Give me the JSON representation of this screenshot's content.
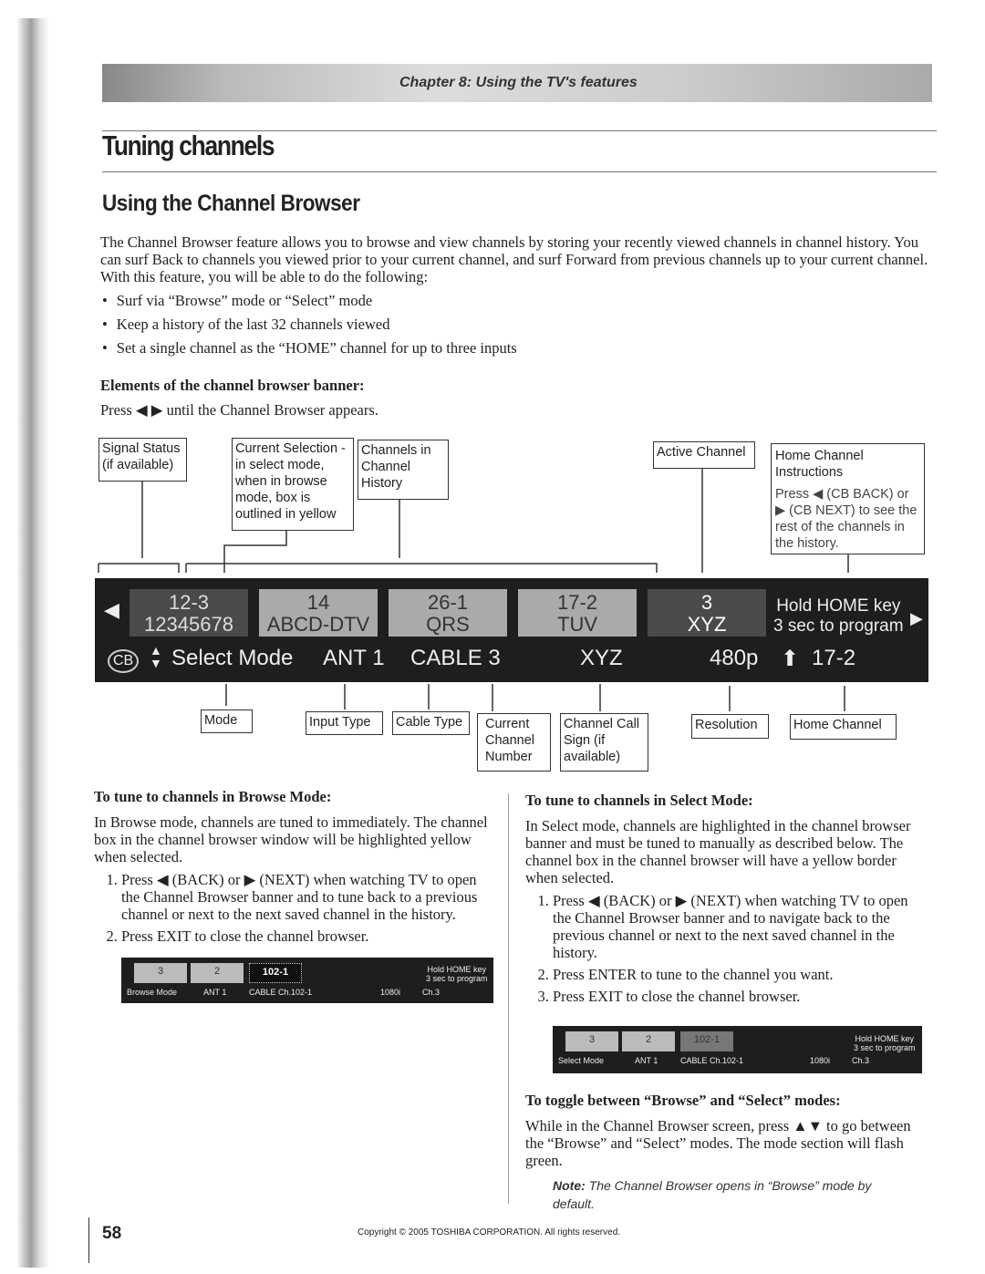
{
  "chapter": "Chapter 8: Using the TV's features",
  "title": "Tuning channels",
  "section": "Using the Channel Browser",
  "intro": "The Channel Browser feature allows you to browse and view channels by storing your recently viewed channels in channel history. You can surf Back to channels you viewed prior to your current channel, and surf Forward from previous channels up to your current channel. With this feature, you will be able to do the following:",
  "bullets": [
    "Surf via “Browse” mode or “Select” mode",
    "Keep a history of the last 32 channels viewed",
    "Set a single channel as the “HOME” channel for up to three inputs"
  ],
  "elements_heading": "Elements of the channel browser banner:",
  "press_line": "Press ◀ ▶ until the Channel Browser appears.",
  "callouts_top": {
    "signal": "Signal Status (if available)",
    "current": "Current Selection - in select mode, when in browse mode, box is outlined in yellow",
    "history": "Channels in Channel History",
    "active": "Active Channel",
    "home": "Home Channel Instructions",
    "home_press": "Press ◀ (CB BACK) or ▶ (CB NEXT) to see the rest of the channels in the history."
  },
  "banner": {
    "cells": [
      {
        "num": "12-3",
        "name": "12345678"
      },
      {
        "num": "14",
        "name": "ABCD-DTV"
      },
      {
        "num": "26-1",
        "name": "QRS"
      },
      {
        "num": "17-2",
        "name": "TUV"
      },
      {
        "num": "3",
        "name": "XYZ"
      }
    ],
    "hold": "Hold HOME key",
    "hold2": "3 sec to program",
    "mode": "Select Mode",
    "input": "ANT 1",
    "cable": "CABLE 3",
    "call": "XYZ",
    "res": "480p",
    "home": "17-2"
  },
  "callouts_bottom": {
    "mode": "Mode",
    "input": "Input Type",
    "cable": "Cable Type",
    "current": "Current Channel Number",
    "call": "Channel Call Sign (if available)",
    "res": "Resolution",
    "home": "Home Channel"
  },
  "browse": {
    "heading": "To tune to channels in Browse Mode:",
    "text": "In Browse mode, channels are tuned to immediately. The channel box in the channel browser window will be highlighted yellow when selected.",
    "steps": [
      "Press ◀ (BACK) or ▶ (NEXT) when watching TV to open the Channel Browser banner and to tune back to a previous channel or next to the next saved channel in the history.",
      "Press EXIT to close the channel browser."
    ],
    "banner": {
      "c1": "3",
      "c2": "2",
      "c3": "102-1",
      "hold": "Hold HOME key",
      "hold2": "3 sec to program",
      "mode": "Browse Mode",
      "input": "ANT 1",
      "cable": "CABLE  Ch.102-1",
      "res": "1080i",
      "home": "Ch.3"
    }
  },
  "select": {
    "heading": "To tune to channels in Select Mode:",
    "text": "In Select mode, channels are highlighted in the channel browser banner and must be tuned to manually as described below. The channel box in the channel browser will have a yellow border when selected.",
    "steps": [
      "Press ◀ (BACK) or ▶ (NEXT) when watching TV to open the Channel Browser banner and to navigate back to the previous channel or next to the next saved channel in the history.",
      "Press ENTER to tune to the channel you want.",
      "Press EXIT to close the channel browser."
    ],
    "banner": {
      "c1": "3",
      "c2": "2",
      "c3": "102-1",
      "hold": "Hold HOME key",
      "hold2": "3 sec to program",
      "mode": "Select Mode",
      "input": "ANT 1",
      "cable": "CABLE  Ch.102-1",
      "res": "1080i",
      "home": "Ch.3"
    }
  },
  "toggle": {
    "heading": "To toggle between “Browse” and “Select” modes:",
    "text": "While in the Channel Browser screen, press ▲▼ to go between the “Browse” and “Select” modes. The mode section will flash green.",
    "note_label": "Note:",
    "note": "The Channel Browser opens in “Browse” mode by default."
  },
  "page_number": "58",
  "copyright": "Copyright © 2005 TOSHIBA CORPORATION. All rights reserved."
}
